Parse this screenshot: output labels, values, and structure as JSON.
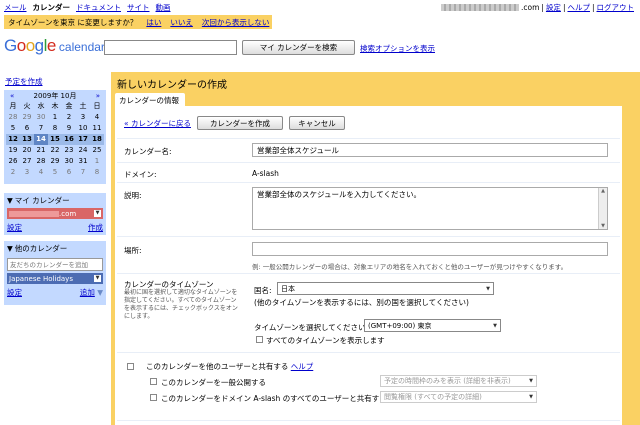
{
  "topnav": {
    "items": [
      "メール",
      "カレンダー",
      "ドキュメント",
      "サイト",
      "動画"
    ],
    "current": "カレンダー"
  },
  "account": {
    "email_suffix": ".com",
    "sep": "|",
    "links": [
      "設定",
      "ヘルプ",
      "ログアウト"
    ]
  },
  "tzbar": {
    "question": "タイムゾーンを東京 に変更しますか？",
    "yes": "はい",
    "no": "いいえ",
    "never": "次回から表示しない"
  },
  "logo": {
    "g": "G",
    "o1": "o",
    "o2": "o",
    "g2": "g",
    "l": "l",
    "e": "e",
    "product": "calendar"
  },
  "search": {
    "value": "",
    "button": "マイ カレンダーを検索",
    "options": "検索オプションを表示"
  },
  "sidebar": {
    "create": "予定を作成",
    "minical": {
      "prev": "«",
      "title": "2009年 10月",
      "next": "»",
      "weekdays": [
        "月",
        "火",
        "水",
        "木",
        "金",
        "土",
        "日"
      ],
      "weeks": [
        [
          "28",
          "29",
          "30",
          "1",
          "2",
          "3",
          "4"
        ],
        [
          "5",
          "6",
          "7",
          "8",
          "9",
          "10",
          "11"
        ],
        [
          "12",
          "13",
          "14",
          "15",
          "16",
          "17",
          "18"
        ],
        [
          "19",
          "20",
          "21",
          "22",
          "23",
          "24",
          "25"
        ],
        [
          "26",
          "27",
          "28",
          "29",
          "30",
          "31",
          "1"
        ],
        [
          "2",
          "3",
          "4",
          "5",
          "6",
          "7",
          "8"
        ]
      ],
      "current_week": 2,
      "today_index": 2
    },
    "mycal": {
      "title": "マイ カレンダー",
      "entry_suffix": ".com",
      "settings": "設定",
      "create": "作成"
    },
    "othercal": {
      "title": "他のカレンダー",
      "placeholder": "友だちのカレンダーを追加",
      "entry": "Japanese Holidays",
      "settings": "設定",
      "add": "追加"
    }
  },
  "main": {
    "title": "新しいカレンダーの作成",
    "tab": "カレンダーの情報",
    "back": "« カレンダーに戻る",
    "create_btn": "カレンダーを作成",
    "cancel_btn": "キャンセル",
    "name_label": "カレンダー名:",
    "name_value": "営業部全体スケジュール",
    "domain_label": "ドメイン:",
    "domain_value": "A-slash",
    "desc_label": "説明:",
    "desc_value": "営業部全体のスケジュールを入力してください。",
    "place_label": "場所:",
    "place_value": "",
    "place_hint": "例: 一般公開カレンダーの場合は、対象エリアの地名を入れておくと他のユーザーが見つけやすくなります。",
    "tz_label": "カレンダーのタイムゾーン",
    "tz_hint": "最初に国を選択して適切なタイムゾーンを指定してください。すべてのタイムゾーンを表示するには、チェックボックスをオンにします。",
    "country_label": "国名:",
    "country_value": "日本",
    "country_note": "(他のタイムゾーンを表示するには、別の国を選択してください)",
    "tz_select_label": "タイムゾーンを選択してください:",
    "tz_select_value": "(GMT+09:00) 東京",
    "show_all_tz": "すべてのタイムゾーンを表示します",
    "share_label": "このカレンダーを他のユーザーと共有する",
    "share_help": "ヘルプ",
    "public_label": "このカレンダーを一般公開する",
    "public_select": "予定の時間枠のみを表示 (詳細を非表示)",
    "domain_share_label": "このカレンダーをドメイン A-slash のすべてのユーザーと共有する",
    "domain_share_select": "閲覧権限 (すべての予定の詳細)"
  },
  "colors": {
    "accent": "#fad163",
    "sidebar": "#c3d9ff",
    "mycal_pill": "#d96666",
    "othercal_pill": "#4c6cb3",
    "link": "#0000cc"
  }
}
